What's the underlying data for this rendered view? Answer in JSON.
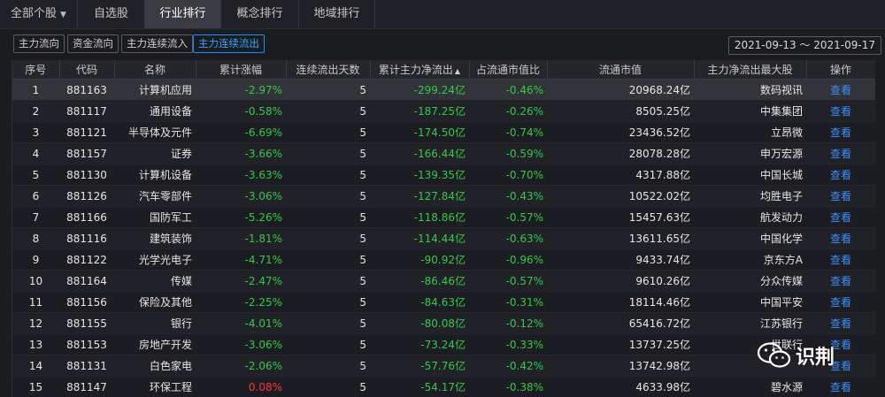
{
  "tabs": [
    {
      "label": "全部个股",
      "has_caret": true
    },
    {
      "label": "自选股"
    },
    {
      "label": "行业排行",
      "active": true
    },
    {
      "label": "概念排行"
    },
    {
      "label": "地域排行"
    }
  ],
  "filters": [
    "主力流向",
    "资金流向",
    "主力连续流入",
    "主力连续流出"
  ],
  "active_filter": "主力连续流出",
  "date_range": "2021-09-13 ～ 2021-09-17",
  "columns": [
    "序号",
    "代码",
    "名称",
    "累计涨幅",
    "连续流出天数",
    "累计主力净流出",
    "占流通市值比",
    "流通市值",
    "主力净流出最大股",
    "操作"
  ],
  "sorted_column_index": 5,
  "sort_direction": "asc",
  "rows": [
    {
      "idx": "1",
      "code": "881163",
      "name": "计算机应用",
      "change": "-2.97%",
      "days": "5",
      "outflow": "-299.24亿",
      "ratio": "-0.46%",
      "mcap": "20968.24亿",
      "top": "数码视讯",
      "action": "查看"
    },
    {
      "idx": "2",
      "code": "881117",
      "name": "通用设备",
      "change": "-0.58%",
      "days": "5",
      "outflow": "-187.25亿",
      "ratio": "-0.26%",
      "mcap": "8505.25亿",
      "top": "中集集团",
      "action": "查看"
    },
    {
      "idx": "3",
      "code": "881121",
      "name": "半导体及元件",
      "change": "-6.69%",
      "days": "5",
      "outflow": "-174.50亿",
      "ratio": "-0.74%",
      "mcap": "23436.52亿",
      "top": "立昂微",
      "action": "查看"
    },
    {
      "idx": "4",
      "code": "881157",
      "name": "证券",
      "change": "-3.66%",
      "days": "5",
      "outflow": "-166.44亿",
      "ratio": "-0.59%",
      "mcap": "28078.28亿",
      "top": "申万宏源",
      "action": "查看"
    },
    {
      "idx": "5",
      "code": "881130",
      "name": "计算机设备",
      "change": "-3.63%",
      "days": "5",
      "outflow": "-139.35亿",
      "ratio": "-0.70%",
      "mcap": "4317.88亿",
      "top": "中国长城",
      "action": "查看"
    },
    {
      "idx": "6",
      "code": "881126",
      "name": "汽车零部件",
      "change": "-3.06%",
      "days": "5",
      "outflow": "-127.84亿",
      "ratio": "-0.43%",
      "mcap": "10522.02亿",
      "top": "均胜电子",
      "action": "查看"
    },
    {
      "idx": "7",
      "code": "881166",
      "name": "国防军工",
      "change": "-5.26%",
      "days": "5",
      "outflow": "-118.86亿",
      "ratio": "-0.57%",
      "mcap": "15457.63亿",
      "top": "航发动力",
      "action": "查看"
    },
    {
      "idx": "8",
      "code": "881116",
      "name": "建筑装饰",
      "change": "-1.81%",
      "days": "5",
      "outflow": "-114.44亿",
      "ratio": "-0.63%",
      "mcap": "13611.65亿",
      "top": "中国化学",
      "action": "查看"
    },
    {
      "idx": "9",
      "code": "881122",
      "name": "光学光电子",
      "change": "-4.71%",
      "days": "5",
      "outflow": "-90.92亿",
      "ratio": "-0.96%",
      "mcap": "9433.74亿",
      "top": "京东方A",
      "action": "查看"
    },
    {
      "idx": "10",
      "code": "881164",
      "name": "传媒",
      "change": "-2.47%",
      "days": "5",
      "outflow": "-86.46亿",
      "ratio": "-0.57%",
      "mcap": "9610.26亿",
      "top": "分众传媒",
      "action": "查看"
    },
    {
      "idx": "11",
      "code": "881156",
      "name": "保险及其他",
      "change": "-2.25%",
      "days": "5",
      "outflow": "-84.63亿",
      "ratio": "-0.31%",
      "mcap": "18114.46亿",
      "top": "中国平安",
      "action": "查看"
    },
    {
      "idx": "12",
      "code": "881155",
      "name": "银行",
      "change": "-4.01%",
      "days": "5",
      "outflow": "-80.08亿",
      "ratio": "-0.12%",
      "mcap": "65416.72亿",
      "top": "江苏银行",
      "action": "查看"
    },
    {
      "idx": "13",
      "code": "881153",
      "name": "房地产开发",
      "change": "-3.06%",
      "days": "5",
      "outflow": "-73.24亿",
      "ratio": "-0.33%",
      "mcap": "13737.25亿",
      "top": "世联行",
      "action": "查看"
    },
    {
      "idx": "14",
      "code": "881131",
      "name": "白色家电",
      "change": "-2.06%",
      "days": "5",
      "outflow": "-57.76亿",
      "ratio": "-0.42%",
      "mcap": "13742.98亿",
      "top": "",
      "action": "查看"
    },
    {
      "idx": "15",
      "code": "881147",
      "name": "环保工程",
      "change": "0.08%",
      "days": "5",
      "outflow": "-54.17亿",
      "ratio": "-0.38%",
      "mcap": "4633.98亿",
      "top": "碧水源",
      "action": "查看"
    }
  ],
  "watermark": {
    "text": "识荆",
    "icon": "wechat-icon"
  },
  "colors": {
    "up": "#ff3838",
    "down": "#35c94a",
    "link": "#3a8ff7",
    "accent": "#1e8fff"
  }
}
